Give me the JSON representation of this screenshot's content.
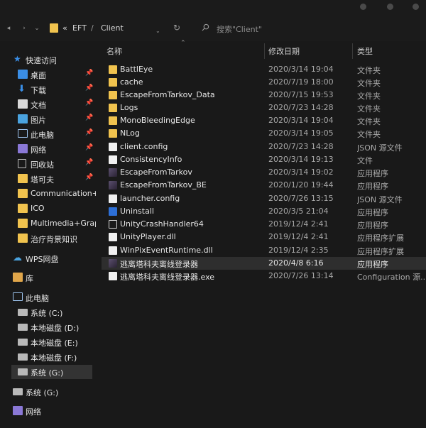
{
  "address": {
    "overflow": "«",
    "crumbs": [
      "EFT",
      "Client"
    ],
    "separator": "/"
  },
  "search": {
    "placeholder": "搜索\"Client\""
  },
  "columns": {
    "name": "名称",
    "date": "修改日期",
    "type": "类型"
  },
  "sidebar": {
    "quick_access": "快速访问",
    "items": [
      {
        "label": "桌面",
        "icon": "desktop-icon",
        "pinned": true
      },
      {
        "label": "下载",
        "icon": "download-icon",
        "pinned": true
      },
      {
        "label": "文档",
        "icon": "document-icon",
        "pinned": true
      },
      {
        "label": "图片",
        "icon": "picture-icon",
        "pinned": true
      },
      {
        "label": "此电脑",
        "icon": "computer-icon",
        "pinned": true
      },
      {
        "label": "网络",
        "icon": "network-icon",
        "pinned": true
      },
      {
        "label": "回收站",
        "icon": "recycle-bin-icon",
        "pinned": true
      },
      {
        "label": "塔可夫",
        "icon": "folder-icon",
        "pinned": true
      },
      {
        "label": "Communication+I",
        "icon": "folder-icon",
        "pinned": false
      },
      {
        "label": "ICO",
        "icon": "folder-icon",
        "pinned": false
      },
      {
        "label": "Multimedia+Grap",
        "icon": "folder-icon",
        "pinned": false
      },
      {
        "label": "治疗背景知识",
        "icon": "folder-icon",
        "pinned": false
      }
    ],
    "wps": "WPS网盘",
    "library": "库",
    "this_pc": "此电脑",
    "drives": [
      "系统 (C:)",
      "本地磁盘 (D:)",
      "本地磁盘 (E:)",
      "本地磁盘 (F:)",
      "系统 (G:)"
    ],
    "drive_g": "系统 (G:)",
    "network": "网络"
  },
  "files": [
    {
      "name": "BattlEye",
      "date": "2020/3/14 19:04",
      "type": "文件夹",
      "icon": "folder"
    },
    {
      "name": "cache",
      "date": "2020/7/19 18:00",
      "type": "文件夹",
      "icon": "folder"
    },
    {
      "name": "EscapeFromTarkov_Data",
      "date": "2020/7/15 19:53",
      "type": "文件夹",
      "icon": "folder"
    },
    {
      "name": "Logs",
      "date": "2020/7/23 14:28",
      "type": "文件夹",
      "icon": "folder"
    },
    {
      "name": "MonoBleedingEdge",
      "date": "2020/3/14 19:04",
      "type": "文件夹",
      "icon": "folder"
    },
    {
      "name": "NLog",
      "date": "2020/3/14 19:05",
      "type": "文件夹",
      "icon": "folder"
    },
    {
      "name": "client.config",
      "date": "2020/7/23 14:28",
      "type": "JSON 源文件",
      "icon": "file"
    },
    {
      "name": "ConsistencyInfo",
      "date": "2020/3/14 19:13",
      "type": "文件",
      "icon": "file"
    },
    {
      "name": "EscapeFromTarkov",
      "date": "2020/3/14 19:02",
      "type": "应用程序",
      "icon": "app"
    },
    {
      "name": "EscapeFromTarkov_BE",
      "date": "2020/1/20 19:44",
      "type": "应用程序",
      "icon": "app"
    },
    {
      "name": "launcher.config",
      "date": "2020/7/26 13:15",
      "type": "JSON 源文件",
      "icon": "file"
    },
    {
      "name": "Uninstall",
      "date": "2020/3/5 21:04",
      "type": "应用程序",
      "icon": "blue"
    },
    {
      "name": "UnityCrashHandler64",
      "date": "2019/12/4 2:41",
      "type": "应用程序",
      "icon": "unity"
    },
    {
      "name": "UnityPlayer.dll",
      "date": "2019/12/4 2:41",
      "type": "应用程序扩展",
      "icon": "file"
    },
    {
      "name": "WinPixEventRuntime.dll",
      "date": "2019/12/4 2:35",
      "type": "应用程序扩展",
      "icon": "file"
    },
    {
      "name": "逃离塔科夫离线登录器",
      "date": "2020/4/8 6:16",
      "type": "应用程序",
      "icon": "app",
      "selected": true
    },
    {
      "name": "逃离塔科夫离线登录器.exe",
      "date": "2020/7/26 13:14",
      "type": "Configuration 源...",
      "icon": "file"
    }
  ]
}
